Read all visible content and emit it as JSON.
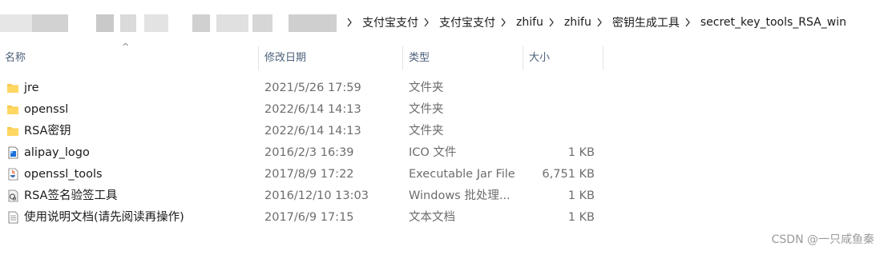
{
  "breadcrumb": [
    "支付宝支付",
    "支付宝支付",
    "zhifu",
    "zhifu",
    "密钥生成工具",
    "secret_key_tools_RSA_win"
  ],
  "columns": {
    "name": "名称",
    "date": "修改日期",
    "type": "类型",
    "size": "大小"
  },
  "files": [
    {
      "name": "jre",
      "date": "2021/5/26 17:59",
      "type": "文件夹",
      "size": "",
      "icon": "folder-icon"
    },
    {
      "name": "openssl",
      "date": "2022/6/14 14:13",
      "type": "文件夹",
      "size": "",
      "icon": "folder-icon"
    },
    {
      "name": "RSA密钥",
      "date": "2022/6/14 14:13",
      "type": "文件夹",
      "size": "",
      "icon": "folder-icon"
    },
    {
      "name": "alipay_logo",
      "date": "2016/2/3 16:39",
      "type": "ICO 文件",
      "size": "1 KB",
      "icon": "ico-file-icon"
    },
    {
      "name": "openssl_tools",
      "date": "2017/8/9 17:22",
      "type": "Executable Jar File",
      "size": "6,751 KB",
      "icon": "jar-file-icon"
    },
    {
      "name": "RSA签名验签工具",
      "date": "2016/12/10 13:03",
      "type": "Windows 批处理...",
      "size": "1 KB",
      "icon": "batch-file-icon"
    },
    {
      "name": "使用说明文档(请先阅读再操作)",
      "date": "2017/6/9 17:15",
      "type": "文本文档",
      "size": "1 KB",
      "icon": "text-file-icon"
    }
  ],
  "watermark": "CSDN @一只咸鱼秦"
}
